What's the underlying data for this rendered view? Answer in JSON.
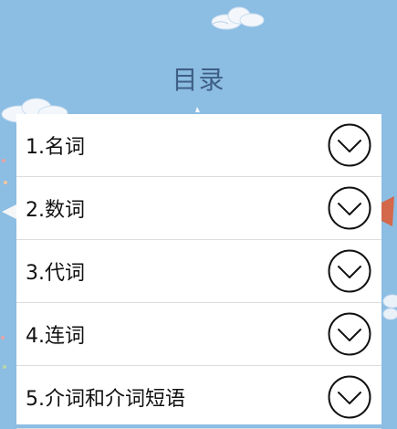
{
  "page": {
    "title": "目录"
  },
  "toc": {
    "items": [
      {
        "label": "1.名词",
        "icon": "chevron-down-circle-icon"
      },
      {
        "label": "2.数词",
        "icon": "chevron-down-circle-icon"
      },
      {
        "label": "3.代词",
        "icon": "chevron-down-circle-icon"
      },
      {
        "label": "4.连词",
        "icon": "chevron-down-circle-icon"
      },
      {
        "label": "5.介词和介词短语",
        "icon": "chevron-down-circle-icon"
      }
    ]
  },
  "colors": {
    "background": "#8cbde3",
    "title": "#3f5f86",
    "panel": "#ffffff",
    "divider": "#dcdcdc",
    "text": "#111111"
  }
}
